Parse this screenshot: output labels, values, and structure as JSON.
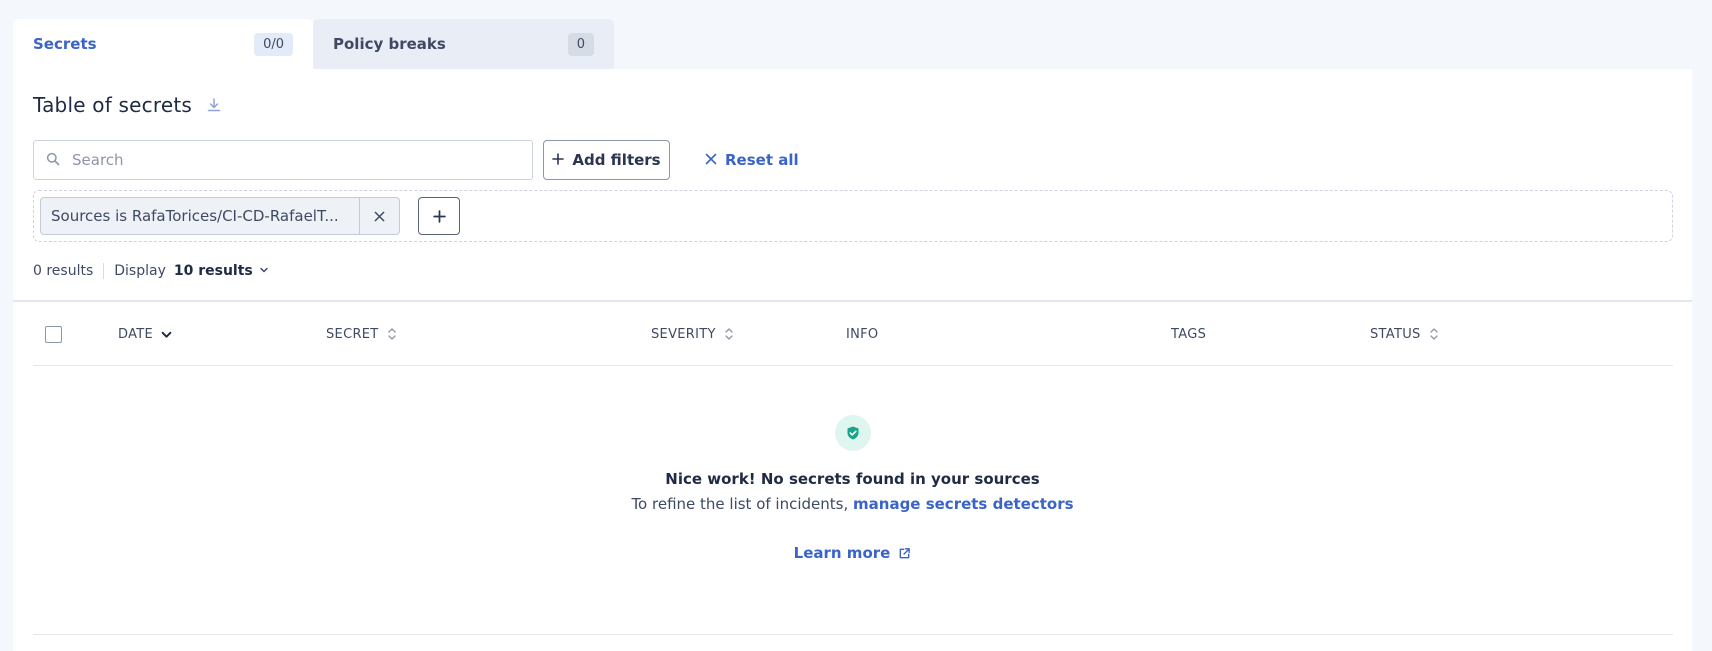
{
  "tabs": [
    {
      "label": "Secrets",
      "count": "0/0"
    },
    {
      "label": "Policy breaks",
      "count": "0"
    }
  ],
  "table_title": "Table of secrets",
  "search": {
    "placeholder": "Search"
  },
  "buttons": {
    "add_filters": "Add filters",
    "reset_all": "Reset all"
  },
  "filter_chip": {
    "label": "Sources is RafaTorices/CI-CD-RafaelT..."
  },
  "results": {
    "count": "0 results",
    "display_label": "Display",
    "display_value": "10 results"
  },
  "columns": [
    "DATE",
    "SECRET",
    "SEVERITY",
    "INFO",
    "TAGS",
    "STATUS"
  ],
  "empty_state": {
    "title": "Nice work! No secrets found in your sources",
    "subtitle_prefix": "To refine the list of incidents,",
    "subtitle_link": "manage secrets detectors",
    "learn_more": "Learn more"
  },
  "colors": {
    "accent": "#3a64c8",
    "text": "#1f2a44",
    "success_bg": "#dff5ef",
    "success_icon": "#1aa58a"
  }
}
